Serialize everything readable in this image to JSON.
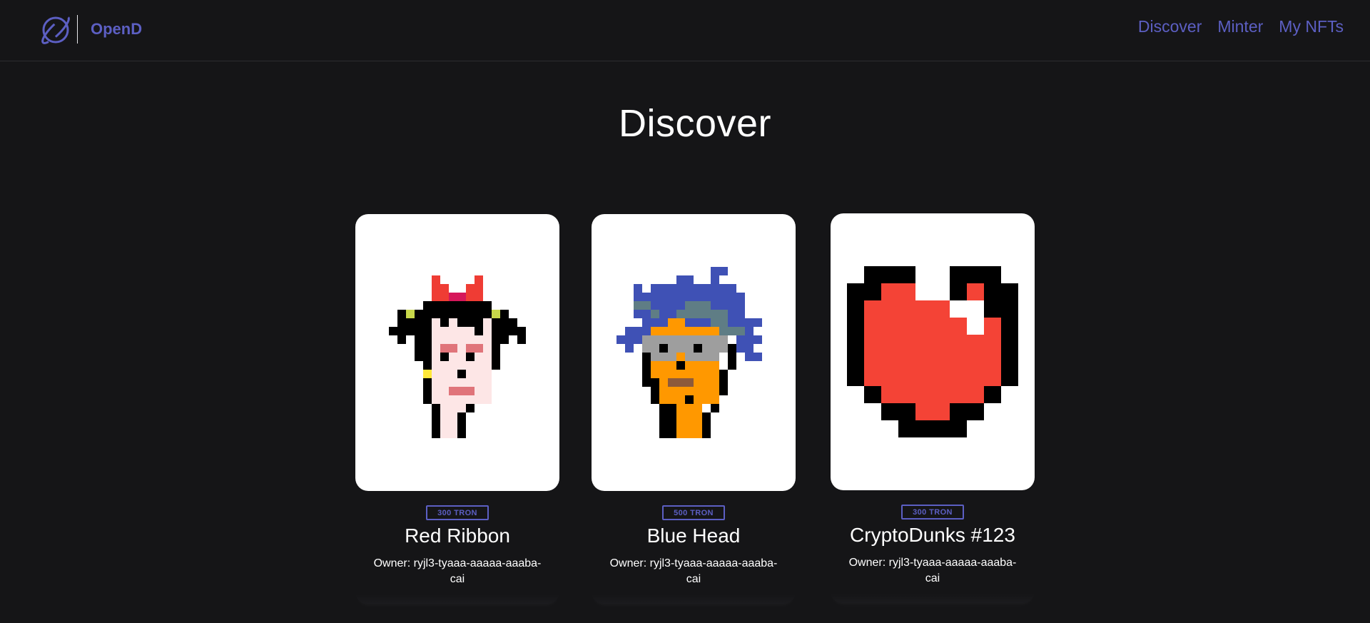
{
  "nav": {
    "brand": "OpenD",
    "links": [
      "Discover",
      "Minter",
      "My NFTs"
    ]
  },
  "page": {
    "title": "Discover"
  },
  "colors": {
    "background": "#151517",
    "accent": "#5c5fc3",
    "text": "#ffffff"
  },
  "cards": [
    {
      "price": "300 TRON",
      "name": "Red Ribbon",
      "owner": "Owner: ryjl3-tyaaa-aaaaa-aaaba-cai",
      "image": "pixel-punk-red-ribbon"
    },
    {
      "price": "500 TRON",
      "name": "Blue Head",
      "owner": "Owner: ryjl3-tyaaa-aaaaa-aaaba-cai",
      "image": "pixel-punk-blue-head"
    },
    {
      "price": "300 TRON",
      "name": "CryptoDunks #123",
      "owner": "Owner: ryjl3-tyaaa-aaaaa-aaaba-cai",
      "image": "pixel-heart"
    }
  ]
}
